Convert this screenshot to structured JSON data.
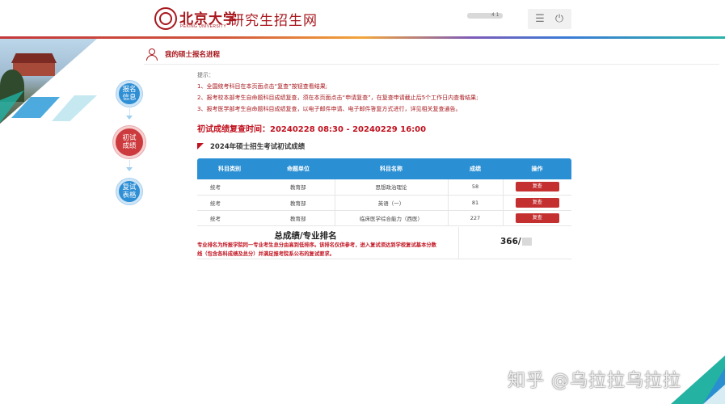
{
  "header": {
    "logo_calligraphy": "北京大学",
    "logo_english": "PEKING UNIVERSITY",
    "site_title": "研究生招生网",
    "user_name": "4 1",
    "menu_icon": "menu-icon",
    "power_icon": "power-icon",
    "menu_glyph": "☰",
    "power_glyph": "⏻"
  },
  "section": {
    "title": "我的硕士报名进程"
  },
  "steps": [
    {
      "line1": "报名",
      "line2": "信息",
      "state": "done"
    },
    {
      "line1": "初试",
      "line2": "成绩",
      "state": "current"
    },
    {
      "line1": "复试",
      "line2": "表格",
      "state": "todo"
    }
  ],
  "tips": {
    "head": "提示：",
    "lines": [
      "1、全国统考科目在本页面点击“复查”按钮查看结果;",
      "2、报考校本部考生自命题科目成绩复查，须在本页面点击“申请复查”，在复查申请截止后5个工作日内查看结果;",
      "3、报考医学部考生自命题科目成绩复查，以电子邮件申请、电子邮件答复方式进行，详见相关复查通告。"
    ]
  },
  "review_time": "初试成绩复查时间：20240228 08:30 - 20240229 16:00",
  "table": {
    "title": "2024年硕士招生考试初试成绩",
    "headers": [
      "科目类别",
      "命题单位",
      "科目名称",
      "成绩",
      "操作"
    ],
    "rows": [
      {
        "category": "统考",
        "unit": "教育部",
        "subject": "思想政治理论",
        "score": "58",
        "action": "复查"
      },
      {
        "category": "统考",
        "unit": "教育部",
        "subject": "英语（一）",
        "score": "81",
        "action": "复查"
      },
      {
        "category": "统考",
        "unit": "教育部",
        "subject": "临床医学综合能力（西医）",
        "score": "227",
        "action": "复查"
      }
    ]
  },
  "summary": {
    "title": "总成绩/专业排名",
    "note_line1": "专业排名为所报学院同一专业考生总分由高到低排序。该排名仅供参考，进入复试须达到学校复试基本分数",
    "note_line2": "线（包含各科成绩及总分）并满足报考院系公布的复试要求。",
    "score": "366/"
  },
  "watermark": "知乎 @乌拉拉乌拉拉",
  "colors": {
    "brand_red": "#a8171d",
    "header_blue": "#2a8fd3",
    "button_red": "#c42f2f"
  }
}
